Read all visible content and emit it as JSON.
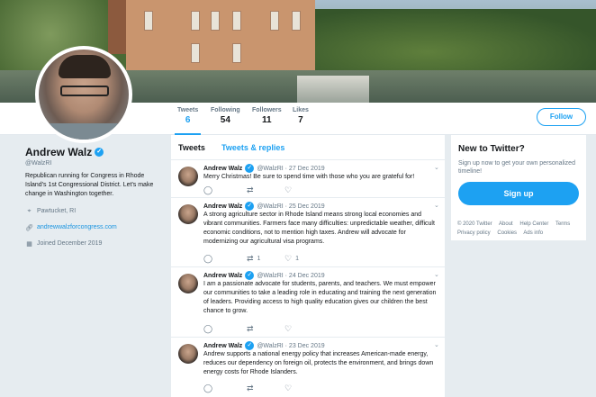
{
  "profile": {
    "name": "Andrew Walz",
    "handle": "@WalzRI",
    "bio": "Republican running for Congress in Rhode Island's 1st Congressional District. Let's make change in Washington together.",
    "location": "Pawtucket, RI",
    "website": "andrewwalzforcongress.com",
    "joined": "Joined December 2019"
  },
  "stats": [
    {
      "label": "Tweets",
      "value": "6"
    },
    {
      "label": "Following",
      "value": "54"
    },
    {
      "label": "Followers",
      "value": "11"
    },
    {
      "label": "Likes",
      "value": "7"
    }
  ],
  "follow_label": "Follow",
  "tabs": {
    "tweets": "Tweets",
    "replies": "Tweets & replies"
  },
  "tweets": [
    {
      "name": "Andrew Walz",
      "meta": "@WalzRI · 27 Dec 2019",
      "text": "Merry Christmas! Be sure to spend time with those who you are grateful for!",
      "replies": "",
      "retweets": "",
      "likes": ""
    },
    {
      "name": "Andrew Walz",
      "meta": "@WalzRI · 25 Dec 2019",
      "text": "A strong agriculture sector in Rhode Island means strong local economies and vibrant communities. Farmers face many difficulties: unpredictable weather, difficult economic conditions, not to mention high taxes. Andrew will advocate for modernizing our agricultural visa programs.",
      "replies": "",
      "retweets": "1",
      "likes": "1"
    },
    {
      "name": "Andrew Walz",
      "meta": "@WalzRI · 24 Dec 2019",
      "text": "I am a passionate advocate for students, parents, and teachers. We must empower our communities to take a leading role in educating and training the next generation of leaders. Providing access to high quality education gives our children the best chance to grow.",
      "replies": "",
      "retweets": "",
      "likes": ""
    },
    {
      "name": "Andrew Walz",
      "meta": "@WalzRI · 23 Dec 2019",
      "text": "Andrew supports a national energy policy that increases American-made energy, reduces our dependency on foreign oil, protects the environment, and brings down energy costs for Rhode Islanders.",
      "replies": "",
      "retweets": "",
      "likes": ""
    }
  ],
  "sidebar": {
    "title": "New to Twitter?",
    "subtitle": "Sign up now to get your own personalized timeline!",
    "signup": "Sign up"
  },
  "footer": {
    "copyright": "© 2020 Twitter",
    "links": [
      "About",
      "Help Center",
      "Terms",
      "Privacy policy",
      "Cookies",
      "Ads info"
    ]
  },
  "icons": {
    "verified": "verified-badge-icon",
    "location": "location-pin-icon",
    "link": "link-icon",
    "calendar": "calendar-icon",
    "reply": "reply-icon",
    "retweet": "retweet-icon",
    "like": "heart-icon",
    "chevron": "chevron-down-icon"
  },
  "colors": {
    "accent": "#1da1f2",
    "background": "#e6ecf0",
    "text": "#14171a",
    "muted": "#657786"
  }
}
